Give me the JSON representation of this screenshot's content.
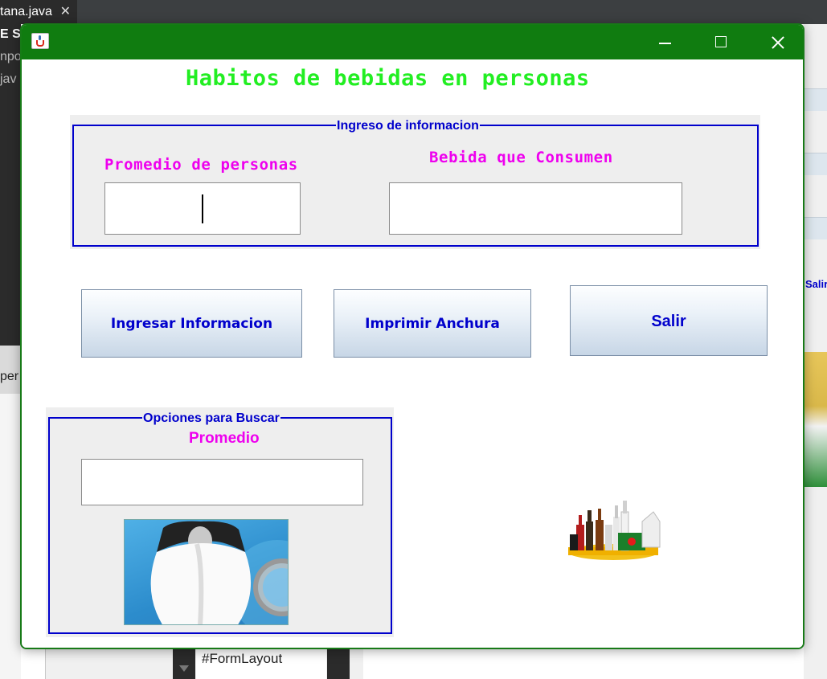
{
  "ide": {
    "tab_label": "tana.java",
    "left_fragments": [
      "E S",
      "npo",
      "jav"
    ],
    "bottom_left_fragment": "per",
    "right_fragment": "Salir",
    "bottom_text": "FormLayout"
  },
  "window": {
    "title": ""
  },
  "main": {
    "title": "Habitos de bebidas en personas",
    "ingreso": {
      "legend": "Ingreso de informacion",
      "promedio_label": "Promedio de personas",
      "promedio_value": "",
      "bebida_label": "Bebida que Consumen",
      "bebida_value": ""
    },
    "buttons": {
      "ingresar": "Ingresar Informacion",
      "imprimir": "Imprimir Anchura",
      "salir": "Salir"
    },
    "opciones": {
      "legend": "Opciones para Buscar",
      "promedio_label": "Promedio",
      "buscar_value": ""
    }
  },
  "colors": {
    "titlebar": "#107c10",
    "title_text": "#22ee22",
    "label_magenta": "#ee00ee",
    "border_blue": "#0000cc"
  },
  "icons": [
    "java-app-icon",
    "minimize-icon",
    "maximize-icon",
    "close-icon",
    "search-user-icon",
    "drinks-image"
  ]
}
